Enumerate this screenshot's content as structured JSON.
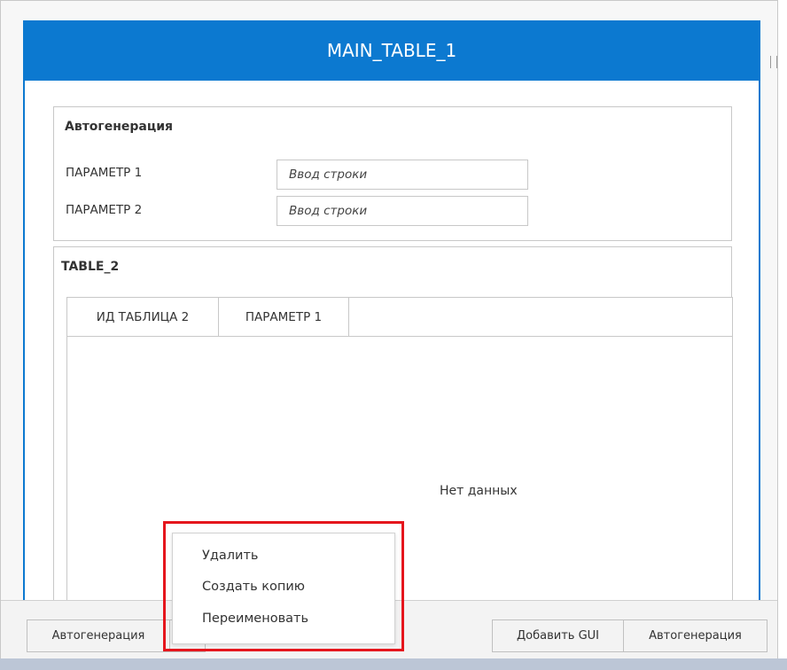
{
  "window": {
    "title": "MAIN_TABLE_1"
  },
  "autogen_panel": {
    "title": "Автогенерация",
    "params": [
      {
        "label": "ПАРАМЕТР 1",
        "placeholder": "Ввод строки"
      },
      {
        "label": "ПАРАМЕТР 2",
        "placeholder": "Ввод строки"
      }
    ]
  },
  "table_panel": {
    "title": "TABLE_2",
    "columns": [
      "ИД ТАБЛИЦА 2",
      "ПАРАМЕТР 1"
    ],
    "empty_text": "Нет данных"
  },
  "footer": {
    "left_button": "Автогенерация",
    "right_buttons": [
      "Добавить GUI",
      "Автогенерация"
    ]
  },
  "context_menu": {
    "items": [
      "Удалить",
      "Создать копию",
      "Переименовать"
    ]
  },
  "colors": {
    "accent": "#0c79d0",
    "highlight": "#e5161d"
  }
}
